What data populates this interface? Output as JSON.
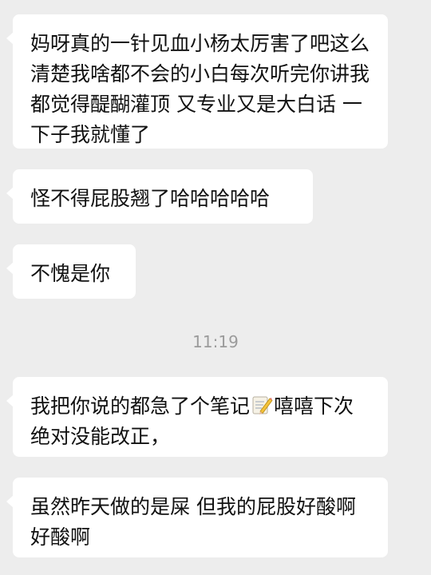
{
  "messages": [
    {
      "text": "妈呀真的一针见血小杨太厉害了吧这么清楚我啥都不会的小白每次听完你讲我都觉得醍醐灌顶 又专业又是大白话 一下子我就懂了"
    },
    {
      "text": "怪不得屁股翘了哈哈哈哈哈"
    },
    {
      "text": "不愧是你"
    },
    {
      "before": "我把你说的都急了个笔记",
      "emoji": "memo-emoji",
      "after": "嘻嘻下次绝对没能改正，"
    },
    {
      "text": "虽然昨天做的是屎 但我的屁股好酸啊好酸啊"
    }
  ],
  "timestamp": "11:19",
  "colors": {
    "background": "#ededed",
    "bubble": "#ffffff",
    "text": "#111111",
    "timestamp": "#9b9b9b"
  }
}
